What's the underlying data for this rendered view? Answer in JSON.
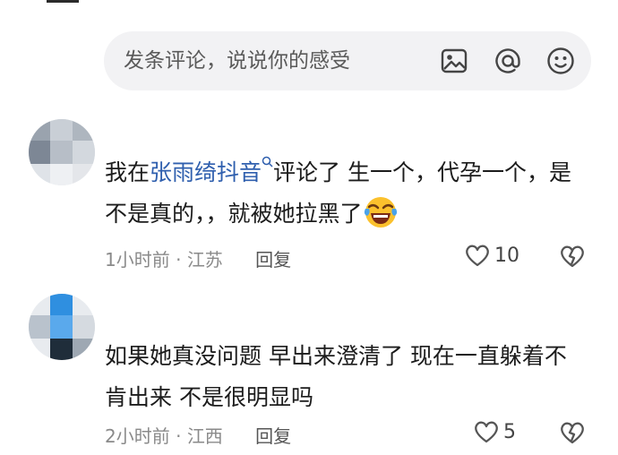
{
  "comment_input": {
    "placeholder": "发条评论，说说你的感受",
    "icons": [
      "image-icon",
      "at-icon",
      "emoji-icon"
    ]
  },
  "comments": [
    {
      "text_before": "我在",
      "mention": "张雨绮抖音",
      "text_after": "评论了 生一个，代孕一个，是不是真的，，就被她拉黑了",
      "emoji": "laughing-crying-emoji",
      "time": "1小时前",
      "separator": "·",
      "location": "江苏",
      "reply_label": "回复",
      "likes": "10"
    },
    {
      "text": "如果她真没问题 早出来澄清了 现在一直躲着不肯出来 不是很明显吗",
      "time": "2小时前",
      "separator": "·",
      "location": "江西",
      "reply_label": "回复",
      "likes": "5"
    }
  ]
}
